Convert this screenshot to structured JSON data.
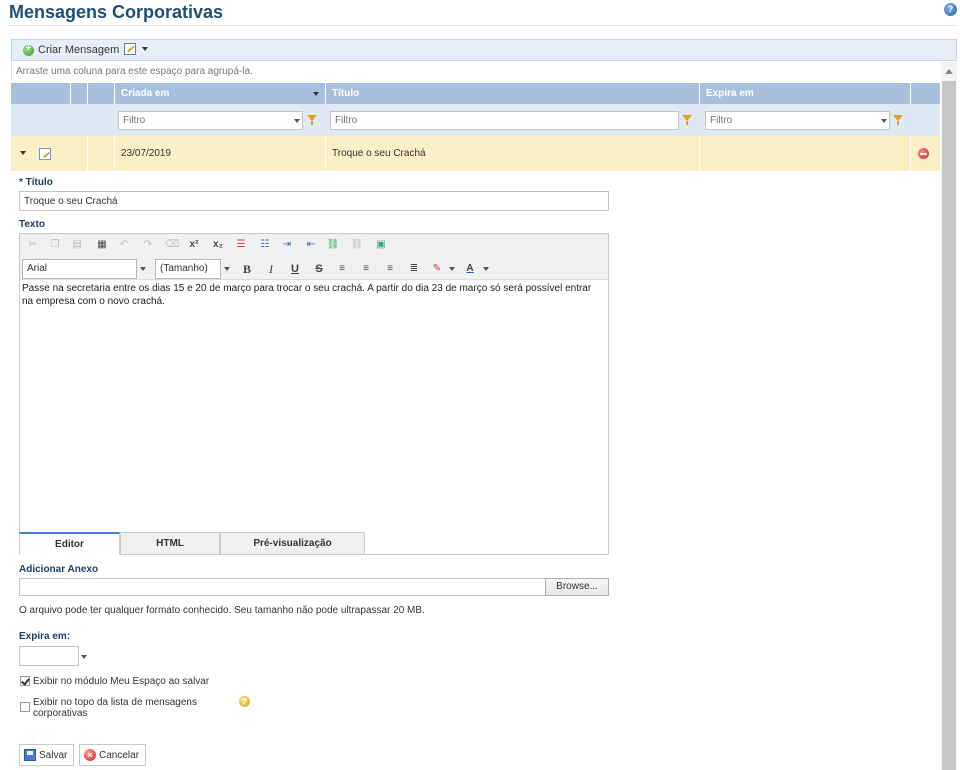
{
  "page": {
    "title": "Mensagens Corporativas"
  },
  "toolbar": {
    "create_label": "Criar Mensagem"
  },
  "grid": {
    "group_hint": "Arraste uma coluna para este espaço para agrupá-la.",
    "columns": [
      "Criada em",
      "Título",
      "Expira em"
    ],
    "filter_placeholder": "Filtro",
    "rows": [
      {
        "created": "23/07/2019",
        "title": "Troque o seu Crachá",
        "expires": ""
      }
    ]
  },
  "form": {
    "title_label": "* Título",
    "title_value": "Troque o seu Crachá",
    "text_label": "Texto",
    "editor": {
      "font": "Arial",
      "size": "(Tamanho)",
      "content": "Passe na secretaria entre os dias 15 e 20 de março para trocar o seu crachá. A partir do dia 23 de março só será possível entrar na empresa com o novo crachá.",
      "tabs": [
        "Editor",
        "HTML",
        "Pré-visualização"
      ],
      "active_tab": "Editor"
    },
    "attachment_label": "Adicionar Anexo",
    "browse_label": "Browse...",
    "attachment_note": "O arquivo pode ter qualquer formato conhecido. Seu tamanho não pode ultrapassar 20 MB.",
    "expires_label": "Expira em:",
    "show_module_label": "Exibir no módulo Meu Espaço ao salvar",
    "show_module_checked": true,
    "show_top_label": "Exibir no topo da lista de mensagens corporativas",
    "show_top_checked": false,
    "save_label": "Salvar",
    "cancel_label": "Cancelar"
  }
}
